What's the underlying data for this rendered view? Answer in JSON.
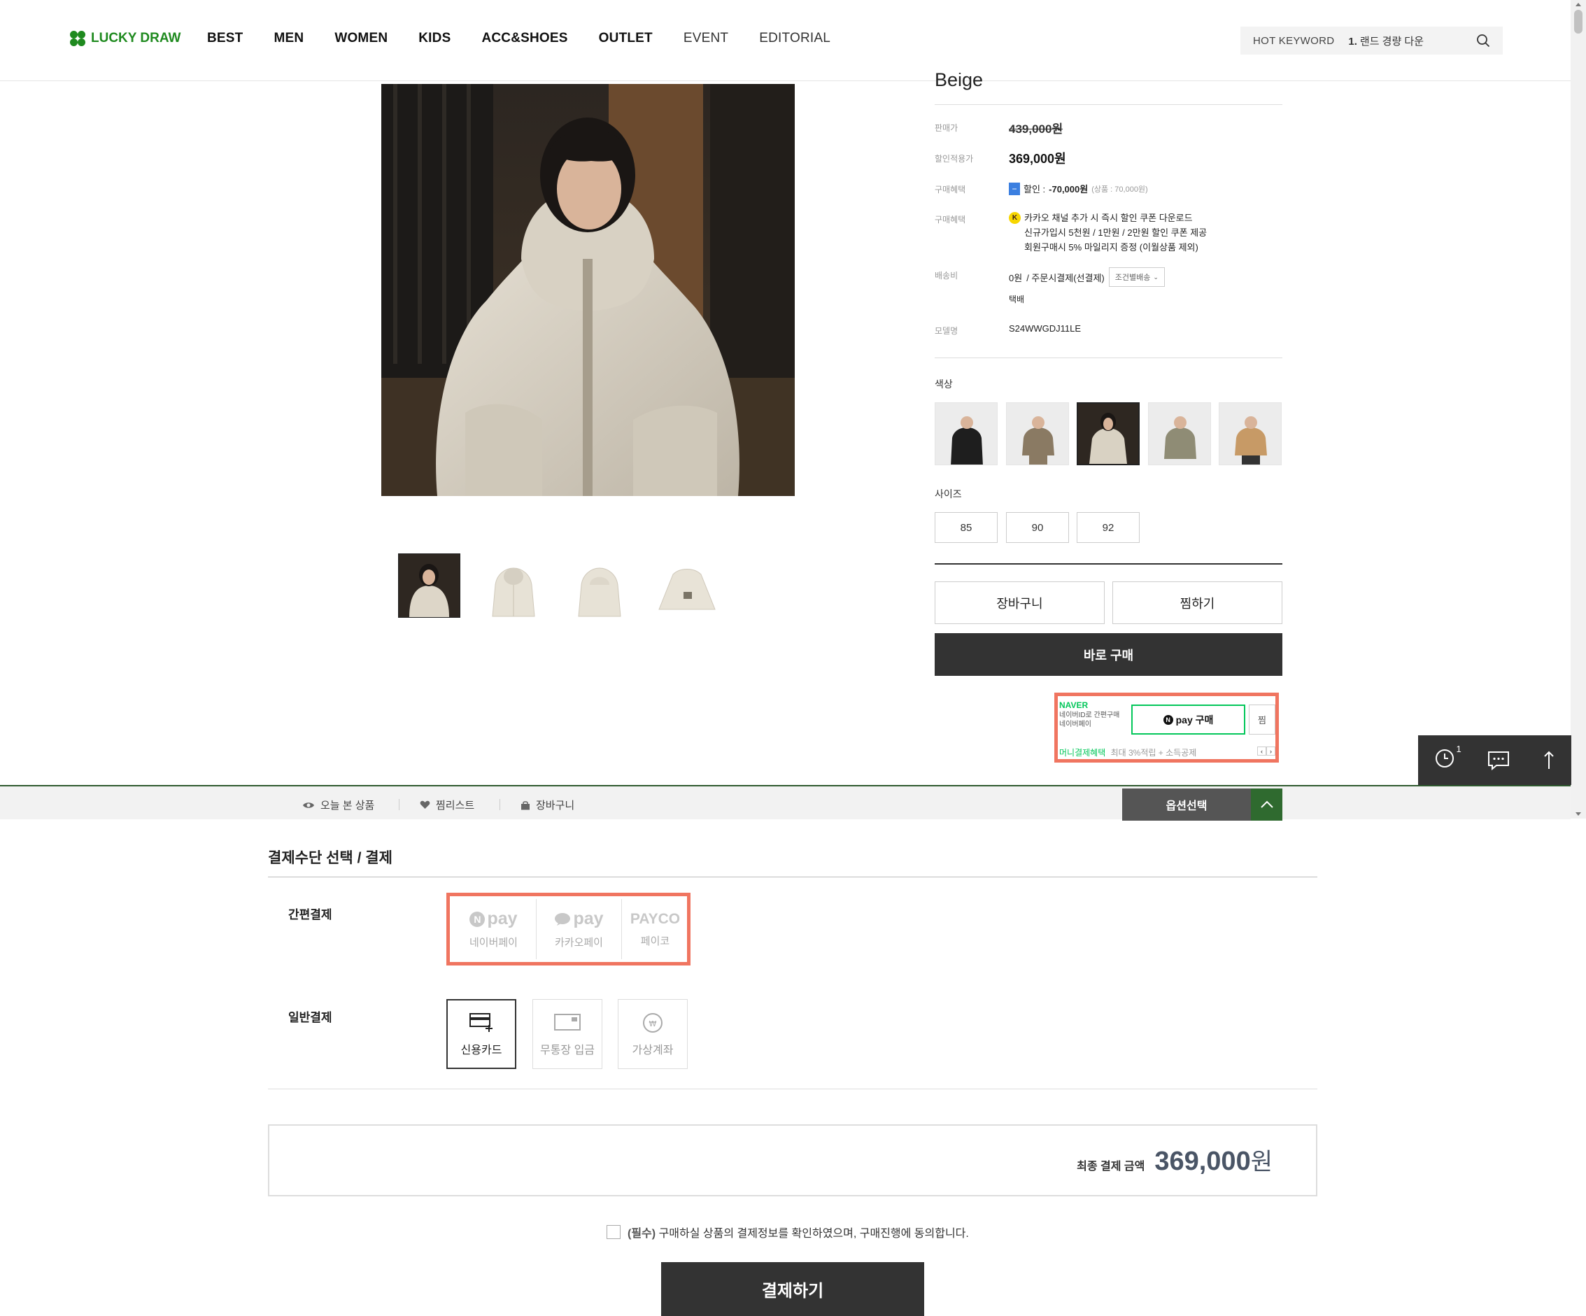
{
  "header": {
    "logo": "LUCKY DRAW",
    "nav": [
      "BEST",
      "MEN",
      "WOMEN",
      "KIDS",
      "ACC&SHOES",
      "OUTLET",
      "EVENT",
      "EDITORIAL"
    ],
    "hot_keyword_label": "HOT KEYWORD",
    "hot_keyword_rank": "1.",
    "hot_keyword_text": "랜드 경량 다운"
  },
  "product": {
    "name": "Beige",
    "labels": {
      "list_price": "판매가",
      "sale_price": "할인적용가",
      "benefit1": "구매혜택",
      "benefit2": "구매혜택",
      "shipping": "배송비",
      "model": "모델명"
    },
    "list_price": "439,000원",
    "sale_price": "369,000원",
    "discount_icon": "−",
    "discount_text": "할인 : ",
    "discount_amount": "-70,000원",
    "discount_detail": "(상품 : 70,000원)",
    "kakao_icon": "K",
    "kakao_line1": "카카오 채널 추가 시 즉시 할인 쿠폰 다운로드",
    "kakao_line2": "신규가입시 5천원 / 1만원 / 2만원 할인 쿠폰 제공",
    "kakao_line3": "회원구매시 5% 마일리지 증정 (이월상품 제외)",
    "shipping_fee": "0원",
    "shipping_method": "/ 주문시결제(선결제)",
    "shipping_select": "조건별배송",
    "shipping_type": "택배",
    "model_no": "S24WWGDJ11LE",
    "color_label": "색상",
    "size_label": "사이즈",
    "sizes": [
      "85",
      "90",
      "92"
    ],
    "cart_button": "장바구니",
    "wish_button": "찜하기",
    "buy_now_button": "바로 구매",
    "colors": [
      "#1e1e1e",
      "#8a7a63",
      "#d9d2c3",
      "#8f8c75",
      "#c79a66"
    ]
  },
  "naver_pay": {
    "brand": "NAVER",
    "line1": "네이버ID로 간편구매",
    "line2": "네이버페이",
    "buy_button_mark": "N",
    "buy_button_text": "pay 구매",
    "wish_button": "찜",
    "promo": "머니결제혜택",
    "promo_detail": "최대 3%적립 + 소득공제"
  },
  "quick_menu": {
    "recent_count": "1"
  },
  "bottom_bar": {
    "recent": "오늘 본 상품",
    "wishlist": "찜리스트",
    "cart": "장바구니",
    "option_select": "옵션선택"
  },
  "payment": {
    "title": "결제수단 선택 / 결제",
    "easy_label": "간편결제",
    "general_label": "일반결제",
    "easy_methods": [
      {
        "logo": "pay",
        "mark": "N",
        "name": "네이버페이"
      },
      {
        "logo": "pay",
        "mark": "",
        "name": "카카오페이"
      },
      {
        "logo": "PAYCO",
        "mark": "",
        "name": "페이코"
      }
    ],
    "general_methods": [
      {
        "name": "신용카드"
      },
      {
        "name": "무통장 입금"
      },
      {
        "name": "가상계좌"
      }
    ],
    "total_label": "최종 결제 금액",
    "total_amount": "369,000",
    "total_unit": "원",
    "agree_required": "(필수)",
    "agree_text": "구매하실 상품의 결제정보를 확인하였으며, 구매진행에 동의합니다.",
    "pay_button": "결제하기"
  }
}
